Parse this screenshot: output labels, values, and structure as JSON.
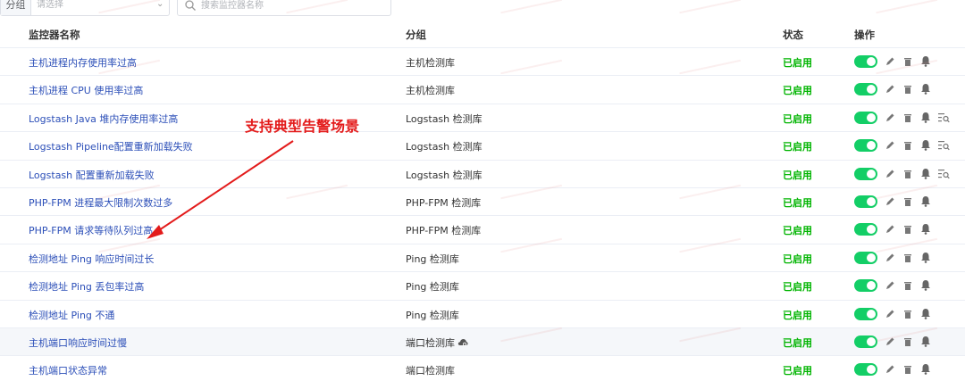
{
  "toolbar": {
    "group_prefix": "分组",
    "group_placeholder": "请选择",
    "search_placeholder": "搜索监控器名称"
  },
  "table": {
    "headers": [
      "监控器名称",
      "分组",
      "状态",
      "操作"
    ],
    "rows": [
      {
        "name": "主机进程内存使用率过高",
        "group": "主机检测库",
        "status": "已启用",
        "extra": false,
        "cloud": false
      },
      {
        "name": "主机进程 CPU 使用率过高",
        "group": "主机检测库",
        "status": "已启用",
        "extra": false,
        "cloud": false
      },
      {
        "name": "Logstash Java 堆内存使用率过高",
        "group": "Logstash 检测库",
        "status": "已启用",
        "extra": true,
        "cloud": false
      },
      {
        "name": "Logstash Pipeline配置重新加载失败",
        "group": "Logstash 检测库",
        "status": "已启用",
        "extra": true,
        "cloud": false
      },
      {
        "name": "Logstash 配置重新加载失败",
        "group": "Logstash 检测库",
        "status": "已启用",
        "extra": true,
        "cloud": false
      },
      {
        "name": "PHP-FPM 进程最大限制次数过多",
        "group": "PHP-FPM 检测库",
        "status": "已启用",
        "extra": false,
        "cloud": false
      },
      {
        "name": "PHP-FPM 请求等待队列过高",
        "group": "PHP-FPM 检测库",
        "status": "已启用",
        "extra": false,
        "cloud": false
      },
      {
        "name": "检测地址 Ping 响应时间过长",
        "group": "Ping 检测库",
        "status": "已启用",
        "extra": false,
        "cloud": false
      },
      {
        "name": "检测地址 Ping 丢包率过高",
        "group": "Ping 检测库",
        "status": "已启用",
        "extra": false,
        "cloud": false
      },
      {
        "name": "检测地址 Ping 不通",
        "group": "Ping 检测库",
        "status": "已启用",
        "extra": false,
        "cloud": false
      },
      {
        "name": "主机端口响应时间过慢",
        "group": "端口检测库",
        "status": "已启用",
        "extra": false,
        "cloud": true
      },
      {
        "name": "主机端口状态异常",
        "group": "端口检测库",
        "status": "已启用",
        "extra": false,
        "cloud": false
      }
    ]
  },
  "annotation": {
    "text": "支持典型告警场景"
  },
  "colors": {
    "link": "#2c4fb8",
    "status_enabled": "#00b400",
    "toggle_on": "#13ce66",
    "annotation": "#e31b1b",
    "header_border": "#ebeef5"
  },
  "icons": {
    "search": "search-icon",
    "chevron": "chevron-down-icon",
    "edit": "pencil-icon",
    "delete": "trash-icon",
    "bell": "bell-icon",
    "extra": "list-search-icon",
    "cloud": "cloud-gear-icon"
  }
}
